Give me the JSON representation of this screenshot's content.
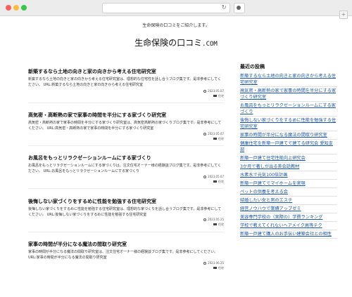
{
  "header": {
    "tagline": "生命保険の口コミをご紹介します。",
    "site_title": "生命保険の口コミ",
    "site_title_suffix": ".COM"
  },
  "posts": [
    {
      "title": "新築するなら土地の向きと家の向きから考える住宅研究室",
      "excerpt": "新築するなら土地の向きと家の向きから考える住宅研究室は、理想的な住宅性を話し合うブログ集です。是非参考にしてください。 URL:新築するなら土地の向きと家の向きから考える住宅研究室",
      "date": "2023.05.07",
      "category": "住宅"
    },
    {
      "title": "高気密・高断熱の家で家事の時間を半分にする家づくり研究室",
      "excerpt": "高気密・高断熱の家で家事の時間を半分にする家づくり研究室は、高気密高断熱の家づくりブログ集です。是非参考にしてください。 URL:高気密・高断熱の家で家事の時間を半分にする家づくり研究室",
      "date": "2023.05.07",
      "category": "住宅"
    },
    {
      "title": "お風呂をもっとリラクゼーションルームにする家づくり",
      "excerpt": "お風呂をもっとリラクゼーションルームにする家づくりは、注文住宅オーナー様の経験談ブログ集です。是非参考にしてください。 URL:お風呂をもっとリラクゼーションルームにする家づくり",
      "date": "2023.05.07",
      "category": "住宅"
    },
    {
      "title": "後悔しない家づくりをするめに性能を勉強する住宅研究室",
      "excerpt": "後悔しない家づくりをするめに性能を勉強する住宅研究室は、理想的な家づくりを話し合うブログ集です。是非参考にしてください。 URL:後悔しない家づくりをするめに性能を勉強する住宅研究室",
      "date": "2023.05.25",
      "category": "住宅"
    },
    {
      "title": "家事の時間が半分になる魔法の間取り研究室",
      "excerpt": "家事の時間が半分になる魔法の間取り研究室は、注文住宅オーナー様の経験談ブログ集です。是非参考にしてください。 URL:家事の時間が半分になる魔法の間取り研究室",
      "date": "2023.06.25",
      "category": "住宅"
    }
  ],
  "sidebar": {
    "title": "最近の投稿",
    "items": [
      "新築するなら土地の向きと家の向きから考える住宅研究室",
      "高気密・高断熱の家で家事の時間を半分にする家づくり研究室",
      "お風呂をもっとリラクゼーションルームにする家づくり",
      "後悔しない家づくりをするめに性能を勉強する住宅研究室",
      "家事の時間が半分になる魔法の間取り研究室",
      "健康住宅を新築一戸建てで建てる研究会 愛知支部",
      "新築一戸建て住宅性能向上研究会",
      "3か月で著しが出る英会話教材",
      "水素水で元気100倍計画",
      "新築一戸建てでマイホームを実現",
      "ペットの供養を考える会",
      "結婚したい女と男のエステ",
      "経営ノウハウで業績アップゼミ",
      "美容専門学校の（実際の）学費ランキング",
      "学校で教えてくれないヘアメイク高等テク",
      "新築一戸建て購入のお手伝い建築会社との相性"
    ]
  },
  "colors": {
    "link": "#1a57a8",
    "chrome": "#ececec"
  }
}
